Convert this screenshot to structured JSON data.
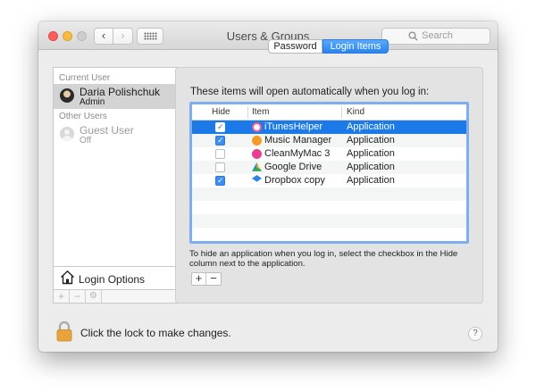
{
  "window": {
    "title": "Users & Groups"
  },
  "search": {
    "placeholder": "Search"
  },
  "sidebar": {
    "current_user_header": "Current User",
    "current_user": {
      "name": "Daria Polishchuk",
      "role": "Admin"
    },
    "other_users_header": "Other Users",
    "other_users": [
      {
        "name": "Guest User",
        "status": "Off"
      }
    ],
    "login_options": "Login Options",
    "toolbar": {
      "add": "+",
      "remove": "−",
      "settings": "⚙"
    }
  },
  "tabs": {
    "password": "Password",
    "login_items": "Login Items"
  },
  "login_items": {
    "intro": "These items will open automatically when you log in:",
    "columns": {
      "hide": "Hide",
      "item": "Item",
      "kind": "Kind"
    },
    "rows": [
      {
        "name": "iTunesHelper",
        "kind": "Application",
        "hide": true,
        "icon": "itunes-icon",
        "color": "#f25a8a"
      },
      {
        "name": "Music Manager",
        "kind": "Application",
        "hide": true,
        "icon": "headphones-icon",
        "color": "#f59a23"
      },
      {
        "name": "CleanMyMac 3",
        "kind": "Application",
        "hide": false,
        "icon": "cleanmymac-icon",
        "color": "#e8408f"
      },
      {
        "name": "Google Drive",
        "kind": "Application",
        "hide": false,
        "icon": "google-drive-icon",
        "color": "#31a853"
      },
      {
        "name": "Dropbox copy",
        "kind": "Application",
        "hide": true,
        "icon": "dropbox-icon",
        "color": "#2f86e6"
      }
    ],
    "hint_line1": "To hide an application when you log in, select the checkbox in the Hide",
    "hint_line2": "column next to the application.",
    "add_label": "+",
    "remove_label": "−"
  },
  "footer": {
    "lock_text": "Click the lock to make changes.",
    "help_label": "?"
  },
  "colors": {
    "accent": "#1c7ae8",
    "lock": "#e8a33c"
  }
}
